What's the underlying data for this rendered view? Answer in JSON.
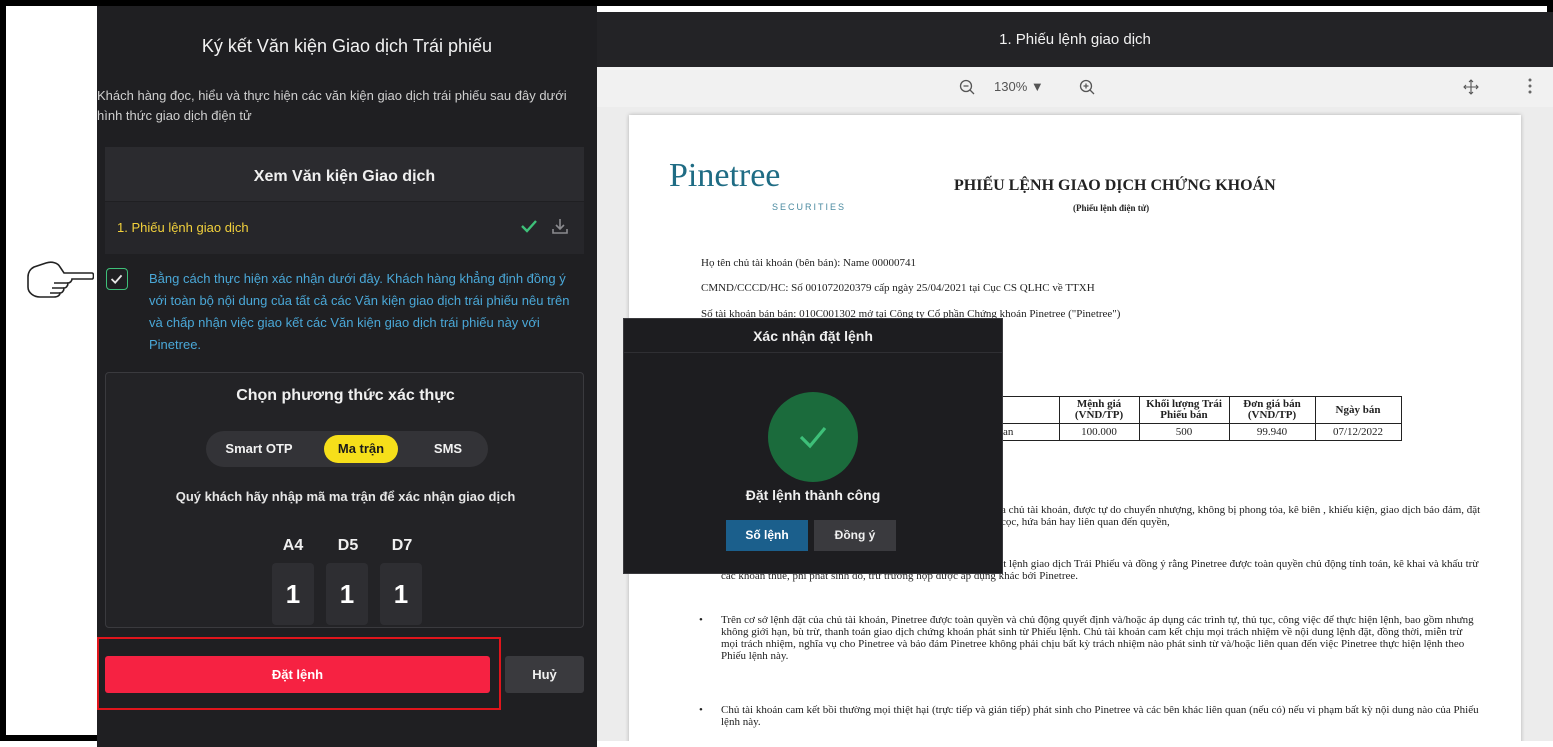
{
  "left": {
    "title": "Ký kết Văn kiện Giao dịch Trái phiếu",
    "description": "Khách hàng đọc, hiểu và thực hiện các văn kiện giao dịch trái phiếu sau đây dưới hình thức giao dịch điện tử",
    "view_title": "Xem Văn kiện Giao dịch",
    "doc_item": "1. Phiếu lệnh giao dịch",
    "agree_text": "Bằng cách thực hiện xác nhận dưới đây. Khách hàng khẳng định đồng ý với toàn bộ nội dung của tất cả các Văn kiện giao dịch trái phiếu nêu trên và chấp nhận việc giao kết các Văn kiện giao dịch trái phiếu này với Pinetree."
  },
  "auth": {
    "title": "Chọn phương thức xác thực",
    "tabs": [
      "Smart OTP",
      "Ma trận",
      "SMS"
    ],
    "hint": "Quý khách hãy nhập mã ma trận để xác nhận giao dịch",
    "labels": [
      "A4",
      "D5",
      "D7"
    ],
    "values": [
      "1",
      "1",
      "1"
    ]
  },
  "buttons": {
    "order": "Đặt lệnh",
    "cancel": "Huỷ"
  },
  "viewer": {
    "title": "1. Phiếu lệnh giao dịch",
    "zoom": "130% ▼"
  },
  "pdf": {
    "logo": "Pinetree",
    "logo_sub": "SECURITIES",
    "title": "PHIẾU LỆNH GIAO DỊCH CHỨNG KHOÁN",
    "subtitle": "(Phiếu lệnh điện tử)",
    "info_1": "Họ tên chủ tài khoản (bên bán): Name 00000741",
    "info_2": "CMND/CCCD/HC: Số 001072020379 cấp ngày 25/04/2021 tại Cục CS QLHC về TTXH",
    "info_3": "Số tài khoản bán bán: 010C001302 mở tại Công ty Cổ phần Chứng khoán Pinetree (\"Pinetree\")",
    "table": {
      "headers": [
        "Mệnh giá (VND/TP)",
        "Khối lượng Trái Phiếu bán",
        "Đơn giá bán (VND/TP)",
        "Ngày bán"
      ],
      "row_prefix": "an",
      "row": [
        "100.000",
        "500",
        "99.940",
        "07/12/2022"
      ]
    },
    "para_1": "a chủ tài khoản, được tự do chuyển nhượng, không bị phong tỏa, kê biên , khiếu kiện, giao dịch bảo đảm, đặt cọc, hứa bán hay liên quan đến quyền,",
    "para_2": "han các khoản thuế, phí phát sinh (nếu có) liên quan đến việc đặt lệnh giao dịch Trái Phiếu và đồng ý rằng Pinetree được toàn quyền chủ động tính toán, kê khai và khấu trừ các khoản thuế, phí phát sinh đó, trừ trường hợp được áp dụng khác bởi Pinetree.",
    "bullet_1": "Trên cơ sở lệnh đặt của chủ tài khoản, Pinetree được toàn quyền và chủ động quyết định và/hoặc áp dụng các trình tự, thủ tục, công việc để thực hiện lệnh, bao gồm nhưng không giới hạn, bù trừ, thanh toán giao dịch chứng khoán phát sinh từ Phiếu lệnh. Chủ tài khoản cam kết chịu mọi trách nhiệm về nội dung lệnh đặt, đồng thời, miễn trừ mọi trách nhiệm, nghĩa vụ cho Pinetree và bảo đảm Pinetree không phải chịu bất kỳ trách nhiệm nào phát sinh từ và/hoặc liên quan đến việc Pinetree thực hiện lệnh theo Phiếu lệnh này.",
    "bullet_2": "Chủ tài khoản cam kết bồi thường mọi thiệt hại (trực tiếp và gián tiếp) phát sinh cho Pinetree và các bên khác liên quan (nếu có) nếu vi phạm bất kỳ nội dung nào của Phiếu lệnh này."
  },
  "modal": {
    "title": "Xác nhận đặt lệnh",
    "message": "Đặt lệnh thành công",
    "order_no": "Số lệnh",
    "agree": "Đồng ý"
  },
  "colors": {
    "accent_yellow": "#f6df1a",
    "order_red": "#f62242",
    "success_green": "#1b6b3c",
    "link_blue": "#4aa8d8"
  }
}
